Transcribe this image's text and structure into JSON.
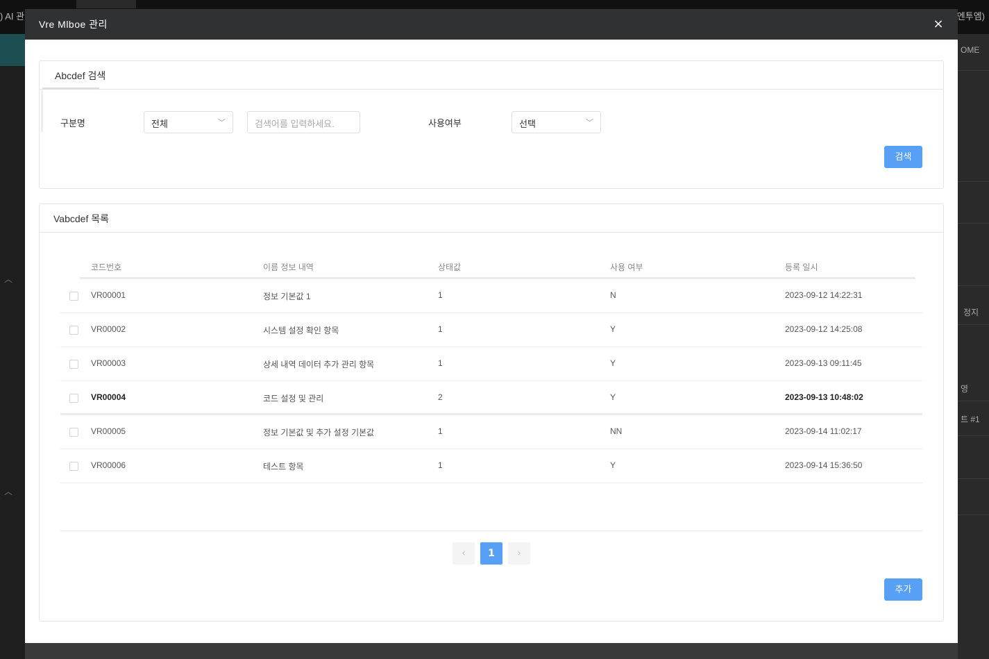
{
  "background": {
    "topbar_left": ") AI 관",
    "topbar_right": "(엔투엠)",
    "right_col": [
      "OME",
      "정지",
      "영",
      "트 #1"
    ]
  },
  "modal": {
    "title": "Vre Mlboe 관리",
    "close_label": "×"
  },
  "search_panel": {
    "title": "Abcdef 검색",
    "field_label": "구분명",
    "select_value": "전체",
    "search_placeholder": "검색어를 입력하세요.",
    "use_label": "사용여부",
    "use_select_value": "선택",
    "search_button": "검색"
  },
  "list_panel": {
    "title": "Vabcdef 목록",
    "columns": [
      "코드번호",
      "이름 정보 내역",
      "상태값",
      "사용 여부",
      "등록 일시"
    ],
    "rows": [
      {
        "code": "VR00001",
        "name": "정보 기본값 1",
        "state": "1",
        "use": "N",
        "date": "2023-09-12 14:22:31"
      },
      {
        "code": "VR00002",
        "name": "시스템 설정 확인 항목",
        "state": "1",
        "use": "Y",
        "date": "2023-09-12 14:25:08"
      },
      {
        "code": "VR00003",
        "name": "상세 내역 데이터 추가 관리 항목",
        "state": "1",
        "use": "Y",
        "date": "2023-09-13 09:11:45"
      },
      {
        "code": "VR00004",
        "name": "코드 설정 및 관리",
        "state": "2",
        "use": "Y",
        "date": "2023-09-13 10:48:02"
      },
      {
        "code": "VR00005",
        "name": "정보 기본값 및 추가 설정 기본값",
        "state": "1",
        "use": "NN",
        "date": "2023-09-14 11:02:17"
      },
      {
        "code": "VR00006",
        "name": "테스트 항목",
        "state": "1",
        "use": "Y",
        "date": "2023-09-14 15:36:50"
      }
    ],
    "pagination": {
      "prev": "‹",
      "current": "1",
      "next": "›"
    },
    "add_button": "추가"
  },
  "colors": {
    "primary": "#58a0f5",
    "header": "#303133"
  }
}
